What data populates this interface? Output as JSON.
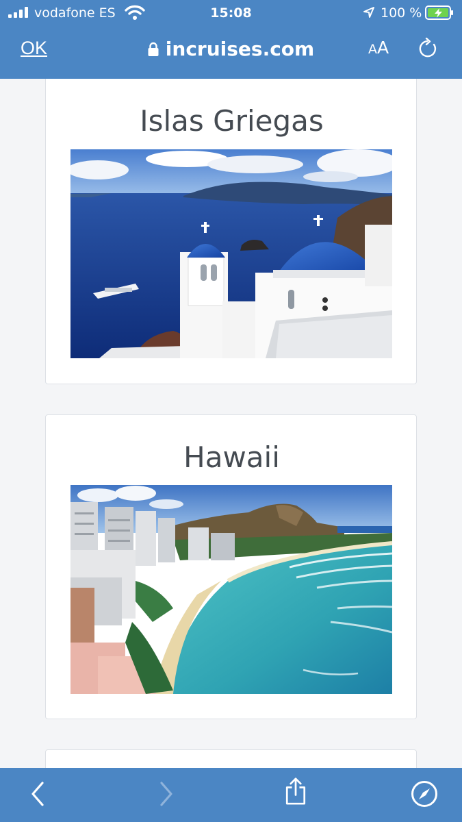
{
  "status_bar": {
    "carrier": "vodafone ES",
    "time": "15:08",
    "battery_percent": "100 %"
  },
  "browser": {
    "done_label": "OK",
    "url": "incruises.com",
    "text_size_small": "A",
    "text_size_large": "A"
  },
  "cards": [
    {
      "title": "Islas Griegas",
      "image": "santorini-photo"
    },
    {
      "title": "Hawaii",
      "image": "waikiki-photo"
    }
  ],
  "toolbar": {
    "icons": [
      "back-icon",
      "forward-icon",
      "share-icon",
      "compass-icon"
    ]
  },
  "colors": {
    "bar": "#4b86c4",
    "page_bg": "#f4f5f7",
    "title_text": "#454b52"
  }
}
